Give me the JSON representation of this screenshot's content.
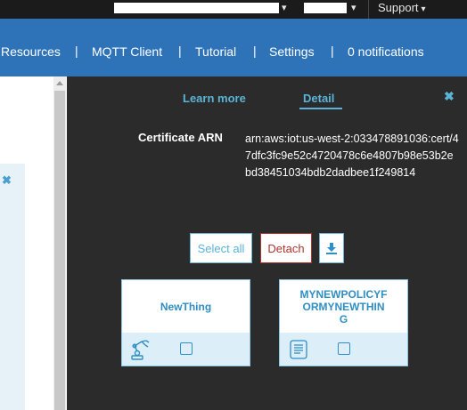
{
  "topbar": {
    "support_label": "Support",
    "caret": "▾"
  },
  "nav": {
    "items": [
      "Resources",
      "MQTT Client",
      "Tutorial",
      "Settings",
      "0 notifications"
    ],
    "separator": "|"
  },
  "left": {
    "close_glyph": "✖"
  },
  "detail": {
    "tabs": [
      "Learn more",
      "Detail"
    ],
    "active_tab": "Detail",
    "close_glyph": "✖",
    "arn_label": "Certificate ARN",
    "arn_value": "arn:aws:iot:us-west-2:033478891036:cert/47dfc3fc9e52c4720478c6e4807b98e53b2ebd38451034bdb2dadbee1f249814",
    "buttons": {
      "select_all": "Select all",
      "detach": "Detach",
      "download_icon": "download-icon"
    },
    "cards": [
      {
        "name": "NewThing",
        "icon": "robot-arm-icon",
        "checked": false
      },
      {
        "name": "MYNEWPOLICYFORMYNEWTHING",
        "icon": "policy-scroll-icon",
        "checked": false
      }
    ]
  },
  "colors": {
    "nav_bg": "#2e73b8",
    "panel_bg": "#2b2b2b",
    "accent": "#5ab4d6",
    "detach_red": "#b3322a"
  }
}
